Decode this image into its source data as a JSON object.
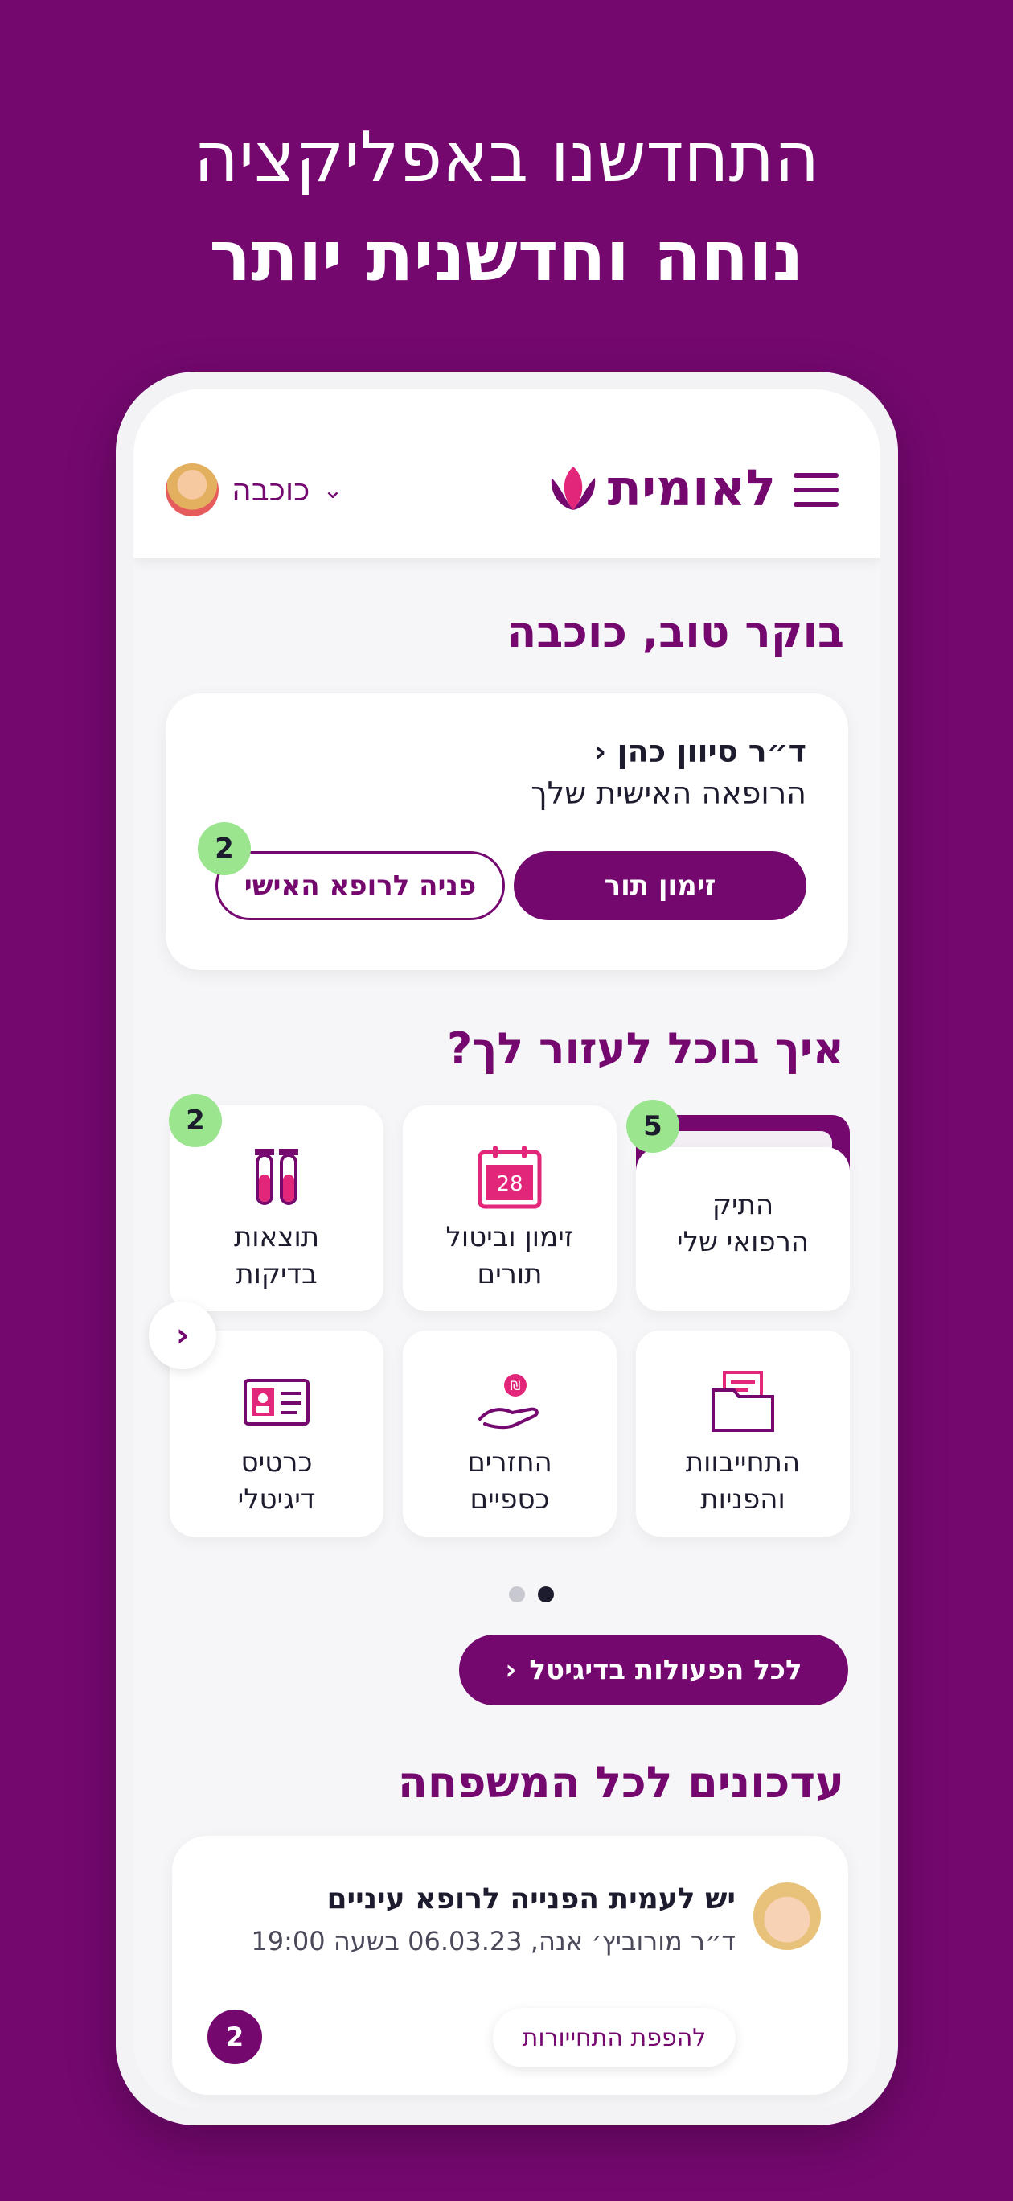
{
  "headline": {
    "line1": "התחדשנו באפליקציה",
    "line2": "נוחה וחדשנית יותר"
  },
  "appbar": {
    "logo_text": "לאומית",
    "user_name": "כוכבה"
  },
  "greeting": "בוקר טוב, כוכבה",
  "doctor_card": {
    "doctor_name": "ד״ר סיוון כהן",
    "subtitle": "הרופאה האישית שלך",
    "appointment_button": "זימון תור",
    "contact_button": "פניה לרופא האישי",
    "contact_badge": "2"
  },
  "help_title": "איך בוכל לעזור לך?",
  "tiles": [
    {
      "line1": "התיק",
      "line2": "הרפואי שלי",
      "icon": "folder-icon",
      "badge": "5"
    },
    {
      "line1": "זימון וביטול",
      "line2": "תורים",
      "icon": "calendar-icon",
      "day": "28"
    },
    {
      "line1": "תוצאות",
      "line2": "בדיקות",
      "icon": "test-tubes-icon",
      "badge": "2"
    },
    {
      "line1": "התחייבוות",
      "line2": "והפניות",
      "icon": "documents-icon"
    },
    {
      "line1": "החזרים",
      "line2": "כספיים",
      "icon": "refund-hand-icon",
      "currency": "₪"
    },
    {
      "line1": "כרטיס",
      "line2": "דיגיטלי",
      "icon": "id-card-icon"
    }
  ],
  "all_actions_button": "לכל הפעולות בדיגיטל",
  "updates_title": "עדכונים לכל המשפחה",
  "update_card": {
    "title": "יש לעמית הפנייה לרופא עיניים",
    "subtitle": "ד״ר מורוביץ׳ אנה, 06.03.23 בשעה 19:00",
    "action": "להפפת התחייורות",
    "badge": "2"
  },
  "colors": {
    "brand_purple": "#74086f",
    "accent_pink": "#e2267a",
    "badge_green": "#9be58f"
  }
}
